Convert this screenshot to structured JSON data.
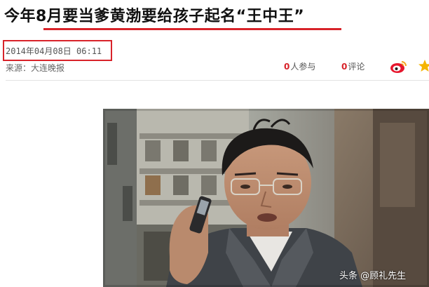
{
  "article": {
    "title": "今年8月要当爹黄渤要给孩子起名“王中王”",
    "date": "2014年04月08日 06:11",
    "source": "来源：大连晚报"
  },
  "meta": {
    "participants_count": "0",
    "participants_label": "人参与",
    "comments_count": "0",
    "comments_label": "评论"
  },
  "watermark": "头条 @顾礼先生",
  "colors": {
    "accent_red": "#d8232a",
    "text_dark": "#111111",
    "text_gray": "#555555"
  },
  "icons": [
    "weibo-icon",
    "star-icon"
  ]
}
